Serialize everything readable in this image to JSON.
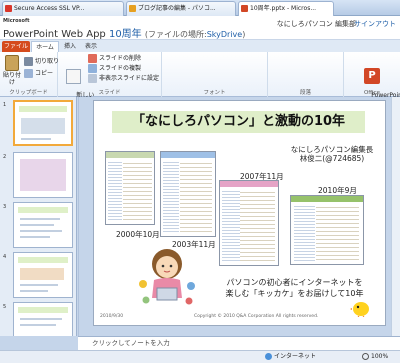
{
  "browser_tabs": [
    {
      "label": "Secure Access SSL VP...",
      "color": "#d9362b"
    },
    {
      "label": "ブログ記事の編集 - パソコ...",
      "color": "#e6a021"
    },
    {
      "label": "10周年.pptx - Micros...",
      "color": "#d24726",
      "active": true
    }
  ],
  "app": {
    "brand": "Microsoft",
    "name": "PowerPoint Web App",
    "doc_title": "10周年",
    "location_prefix": "(ファイルの場所:",
    "location_link": "SkyDrive",
    "location_suffix": ")",
    "user": "なにしろパソコン 編集部",
    "signout": "サインアウト"
  },
  "ribbon": {
    "tabs": [
      "ファイル",
      "ホーム",
      "挿入",
      "表示"
    ],
    "paste": "貼り付け",
    "cut": "切り取り",
    "copy": "コピー",
    "clipboard_label": "クリップボード",
    "new_slide": "新しい\nスライド",
    "delete_slide": "スライドの削除",
    "duplicate_slide": "スライドの複製",
    "hide_slide": "非表示スライドに設定",
    "slides_label": "スライド",
    "font_label": "フォント",
    "paragraph_label": "段落",
    "open_ppt": "PowerPoint\nで開く",
    "office_label": "Office"
  },
  "thumbnails": [
    {
      "num": "1",
      "selected": true
    },
    {
      "num": "2",
      "selected": false
    },
    {
      "num": "3",
      "selected": false
    },
    {
      "num": "4",
      "selected": false
    },
    {
      "num": "5",
      "selected": false
    }
  ],
  "slide": {
    "title": "「なにしろパソコン」と激動の10年",
    "author_line1": "なにしろパソコン編集長",
    "author_line2": "林俊二(@724685)",
    "years": {
      "y2000": "2000年10月",
      "y2003": "2003年11月",
      "y2007": "2007年11月",
      "y2010": "2010年9月"
    },
    "message_line1": "パソコンの初心者にインターネットを",
    "message_line2": "楽しむ「キッカケ」をお届けして10年",
    "date": "2010/9/30",
    "copyright": "Copyright © 2010 Q&A Corporation All rights reserved."
  },
  "notes_placeholder": "クリックしてノートを入力",
  "status": {
    "network": "インターネット",
    "zoom": "100%"
  }
}
